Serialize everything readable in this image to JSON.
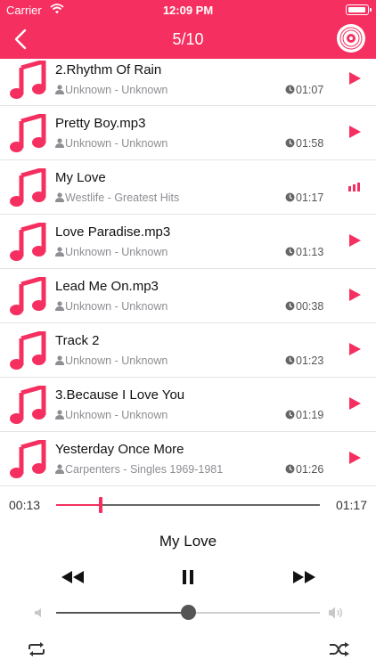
{
  "theme": {
    "accent": "#f53060"
  },
  "status_bar": {
    "carrier": "Carrier",
    "time": "12:09 PM"
  },
  "nav": {
    "title": "5/10",
    "back_icon": "chevron-left-icon",
    "disc_icon": "disc-icon"
  },
  "tracks": [
    {
      "title": "2.Rhythm Of Rain",
      "meta": "Unknown - Unknown",
      "duration": "01:07",
      "state": "play"
    },
    {
      "title": "Pretty Boy.mp3",
      "meta": "Unknown - Unknown",
      "duration": "01:58",
      "state": "play"
    },
    {
      "title": "My Love",
      "meta": "Westlife - Greatest Hits",
      "duration": "01:17",
      "state": "playing"
    },
    {
      "title": "Love Paradise.mp3",
      "meta": "Unknown - Unknown",
      "duration": "01:13",
      "state": "play"
    },
    {
      "title": "Lead Me On.mp3",
      "meta": "Unknown - Unknown",
      "duration": "00:38",
      "state": "play"
    },
    {
      "title": "Track 2",
      "meta": "Unknown - Unknown",
      "duration": "01:23",
      "state": "play"
    },
    {
      "title": "3.Because I Love You",
      "meta": "Unknown - Unknown",
      "duration": "01:19",
      "state": "play"
    },
    {
      "title": "Yesterday Once More",
      "meta": "Carpenters - Singles 1969-1981",
      "duration": "01:26",
      "state": "play"
    }
  ],
  "player": {
    "elapsed": "00:13",
    "total": "01:17",
    "progress_fraction": 0.17,
    "now_playing": "My Love",
    "volume_fraction": 0.5
  }
}
